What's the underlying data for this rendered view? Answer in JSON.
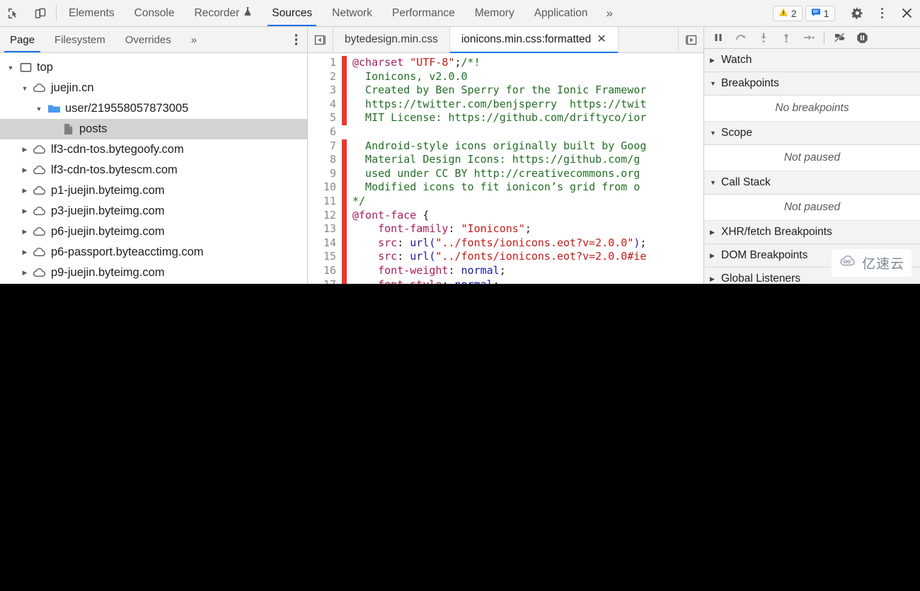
{
  "toolbar": {
    "inspect_icon": "inspect-element-icon",
    "device_icon": "device-toolbar-icon",
    "tabs": [
      {
        "label": "Elements",
        "active": false
      },
      {
        "label": "Console",
        "active": false
      },
      {
        "label": "Recorder",
        "active": false,
        "icon": "flask-icon"
      },
      {
        "label": "Sources",
        "active": true
      },
      {
        "label": "Network",
        "active": false
      },
      {
        "label": "Performance",
        "active": false
      },
      {
        "label": "Memory",
        "active": false
      },
      {
        "label": "Application",
        "active": false
      }
    ],
    "overflow_label": "»",
    "warning_count": "2",
    "message_count": "1",
    "warning_icon": "warning-triangle-icon",
    "message_icon": "message-icon",
    "settings_icon": "gear-icon",
    "menu_icon": "kebab-menu-icon",
    "close_icon": "close-icon"
  },
  "navigator": {
    "tabs": [
      {
        "label": "Page",
        "active": true
      },
      {
        "label": "Filesystem",
        "active": false
      },
      {
        "label": "Overrides",
        "active": false
      }
    ],
    "overflow_label": "»",
    "tree": [
      {
        "label": "top",
        "depth": 0,
        "icon": "frame-icon",
        "twisty": "expanded",
        "selected": false
      },
      {
        "label": "juejin.cn",
        "depth": 1,
        "icon": "cloud-icon",
        "twisty": "expanded",
        "selected": false
      },
      {
        "label": "user/219558057873005",
        "depth": 2,
        "icon": "folder-icon",
        "twisty": "expanded",
        "selected": false
      },
      {
        "label": "posts",
        "depth": 3,
        "icon": "file-icon",
        "twisty": "none",
        "selected": true
      },
      {
        "label": "lf3-cdn-tos.bytegoofy.com",
        "depth": 1,
        "icon": "cloud-icon",
        "twisty": "collapsed",
        "selected": false
      },
      {
        "label": "lf3-cdn-tos.bytescm.com",
        "depth": 1,
        "icon": "cloud-icon",
        "twisty": "collapsed",
        "selected": false
      },
      {
        "label": "p1-juejin.byteimg.com",
        "depth": 1,
        "icon": "cloud-icon",
        "twisty": "collapsed",
        "selected": false
      },
      {
        "label": "p3-juejin.byteimg.com",
        "depth": 1,
        "icon": "cloud-icon",
        "twisty": "collapsed",
        "selected": false
      },
      {
        "label": "p6-juejin.byteimg.com",
        "depth": 1,
        "icon": "cloud-icon",
        "twisty": "collapsed",
        "selected": false
      },
      {
        "label": "p6-passport.byteacctimg.com",
        "depth": 1,
        "icon": "cloud-icon",
        "twisty": "collapsed",
        "selected": false
      },
      {
        "label": "p9-juejin.byteimg.com",
        "depth": 1,
        "icon": "cloud-icon",
        "twisty": "collapsed",
        "selected": false
      }
    ]
  },
  "editor": {
    "scroll_left_icon": "scroll-tabs-left-icon",
    "scroll_right_icon": "scroll-tabs-right-icon",
    "file_tabs": [
      {
        "label": "bytedesign.min.css",
        "active": false,
        "closable": false
      },
      {
        "label": "ionicons.min.css:formatted",
        "active": true,
        "closable": true
      }
    ],
    "close_label": "✕",
    "lines": [
      {
        "n": "1",
        "mark": "red",
        "tokens": [
          {
            "t": "@charset ",
            "c": "at"
          },
          {
            "t": "\"UTF-8\"",
            "c": "str"
          },
          {
            "t": ";",
            "c": "punct"
          },
          {
            "t": "/*!",
            "c": "com"
          }
        ]
      },
      {
        "n": "2",
        "mark": "red",
        "tokens": [
          {
            "t": "  Ionicons, v2.0.0",
            "c": "com"
          }
        ]
      },
      {
        "n": "3",
        "mark": "red",
        "tokens": [
          {
            "t": "  Created by Ben Sperry for the Ionic Framewor",
            "c": "com"
          }
        ]
      },
      {
        "n": "4",
        "mark": "red",
        "tokens": [
          {
            "t": "  https://twitter.com/benjsperry  https://twit",
            "c": "com"
          }
        ]
      },
      {
        "n": "5",
        "mark": "red",
        "tokens": [
          {
            "t": "  MIT License: https://github.com/driftyco/ior",
            "c": "com"
          }
        ]
      },
      {
        "n": "6",
        "mark": "none",
        "tokens": [
          {
            "t": "",
            "c": "com"
          }
        ]
      },
      {
        "n": "7",
        "mark": "red",
        "tokens": [
          {
            "t": "  Android-style icons originally built by Goog",
            "c": "com"
          }
        ]
      },
      {
        "n": "8",
        "mark": "red",
        "tokens": [
          {
            "t": "  Material Design Icons: https://github.com/g",
            "c": "com"
          }
        ]
      },
      {
        "n": "9",
        "mark": "red",
        "tokens": [
          {
            "t": "  used under CC BY http://creativecommons.org",
            "c": "com"
          }
        ]
      },
      {
        "n": "10",
        "mark": "red",
        "tokens": [
          {
            "t": "  Modified icons to fit ionicon’s grid from o",
            "c": "com"
          }
        ]
      },
      {
        "n": "11",
        "mark": "red",
        "tokens": [
          {
            "t": "*/",
            "c": "com"
          }
        ]
      },
      {
        "n": "12",
        "mark": "red",
        "tokens": [
          {
            "t": "@font-face",
            "c": "at"
          },
          {
            "t": " {",
            "c": "punct"
          }
        ]
      },
      {
        "n": "13",
        "mark": "red",
        "tokens": [
          {
            "t": "    font-family",
            "c": "prop"
          },
          {
            "t": ": ",
            "c": "punct"
          },
          {
            "t": "\"Ionicons\"",
            "c": "str"
          },
          {
            "t": ";",
            "c": "punct"
          }
        ]
      },
      {
        "n": "14",
        "mark": "red",
        "tokens": [
          {
            "t": "    src",
            "c": "prop"
          },
          {
            "t": ": ",
            "c": "punct"
          },
          {
            "t": "url(",
            "c": "url"
          },
          {
            "t": "\"../fonts/ionicons.eot?v=2.0.0\"",
            "c": "str"
          },
          {
            "t": ")",
            "c": "url"
          },
          {
            "t": ";",
            "c": "punct"
          }
        ]
      },
      {
        "n": "15",
        "mark": "red",
        "tokens": [
          {
            "t": "    src",
            "c": "prop"
          },
          {
            "t": ": ",
            "c": "punct"
          },
          {
            "t": "url(",
            "c": "url"
          },
          {
            "t": "\"../fonts/ionicons.eot?v=2.0.0#ie",
            "c": "str"
          }
        ]
      },
      {
        "n": "16",
        "mark": "red",
        "tokens": [
          {
            "t": "    font-weight",
            "c": "prop"
          },
          {
            "t": ": ",
            "c": "punct"
          },
          {
            "t": "normal",
            "c": "val"
          },
          {
            "t": ";",
            "c": "punct"
          }
        ]
      },
      {
        "n": "17",
        "mark": "red",
        "tokens": [
          {
            "t": "    font-style",
            "c": "prop"
          },
          {
            "t": ": ",
            "c": "punct"
          },
          {
            "t": "normal",
            "c": "val"
          },
          {
            "t": ";",
            "c": "punct"
          }
        ]
      }
    ]
  },
  "debugger": {
    "buttons": [
      {
        "name": "resume-pause-button",
        "icon": "pause-icon"
      },
      {
        "name": "step-over-button",
        "icon": "step-over-icon"
      },
      {
        "name": "step-into-button",
        "icon": "step-into-icon"
      },
      {
        "name": "step-out-button",
        "icon": "step-out-icon"
      },
      {
        "name": "step-button",
        "icon": "step-icon"
      },
      {
        "name": "deactivate-breakpoints-button",
        "icon": "deactivate-breakpoints-icon"
      },
      {
        "name": "pause-on-exceptions-button",
        "icon": "pause-on-exceptions-icon"
      }
    ],
    "sections": [
      {
        "title": "Watch",
        "state": "collapsed",
        "empty": null
      },
      {
        "title": "Breakpoints",
        "state": "expanded",
        "empty": "No breakpoints"
      },
      {
        "title": "Scope",
        "state": "expanded",
        "empty": "Not paused"
      },
      {
        "title": "Call Stack",
        "state": "expanded",
        "empty": "Not paused"
      },
      {
        "title": "XHR/fetch Breakpoints",
        "state": "collapsed",
        "empty": null
      },
      {
        "title": "DOM Breakpoints",
        "state": "collapsed",
        "empty": null
      },
      {
        "title": "Global Listeners",
        "state": "collapsed",
        "empty": null
      }
    ]
  },
  "watermark": {
    "text": "亿速云",
    "icon": "cloud-logo-icon"
  },
  "colors": {
    "accent": "#1a73e8",
    "warning": "#f5c518",
    "error": "#e8392e",
    "toolbar_bg": "#f3f3f3"
  }
}
